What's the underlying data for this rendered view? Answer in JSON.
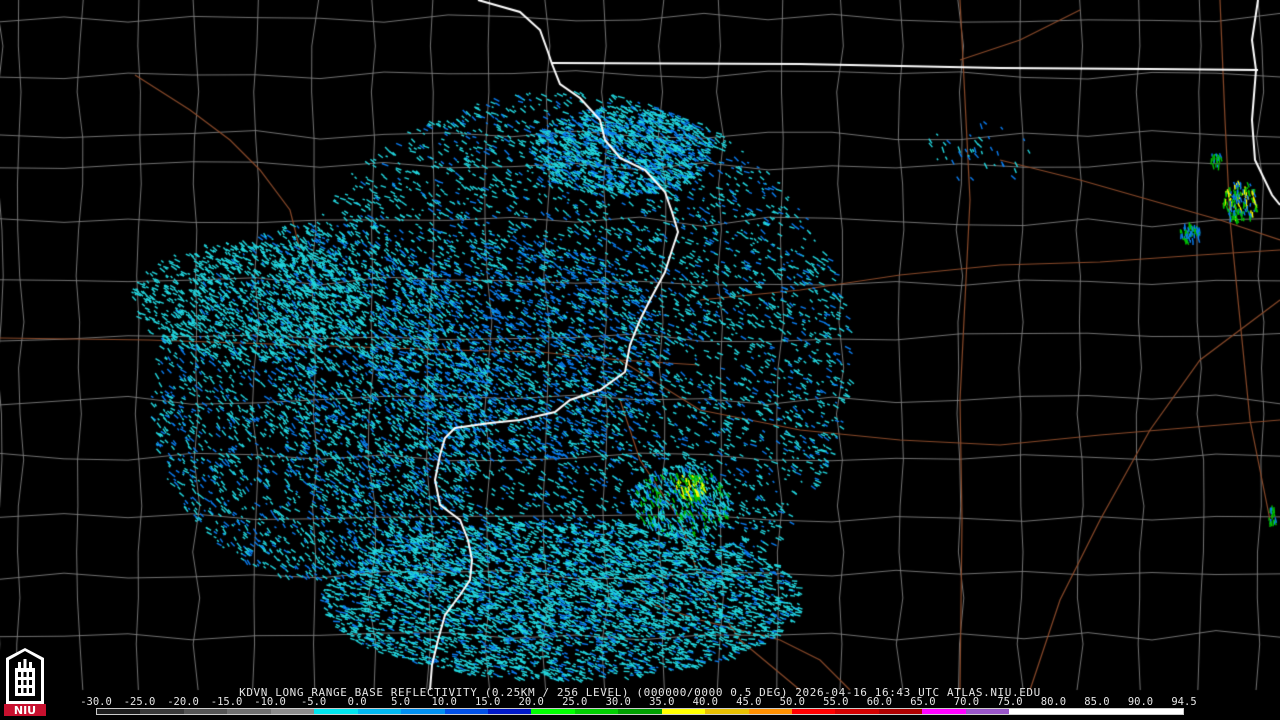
{
  "caption": {
    "station": "KDVN",
    "product": "LONG RANGE BASE REFLECTIVITY",
    "resolution": "(0.25KM / 256 LEVEL)",
    "volume": "(000000/0000 0.5 DEG)",
    "timestamp": "2026-04-16 16:43 UTC",
    "source": "ATLAS.NIU.EDU"
  },
  "scale": {
    "ticks": [
      "-30.0",
      "-25.0",
      "-20.0",
      "-15.0",
      "-10.0",
      "-5.0",
      "0.0",
      "5.0",
      "10.0",
      "15.0",
      "20.0",
      "25.0",
      "30.0",
      "35.0",
      "40.0",
      "45.0",
      "50.0",
      "55.0",
      "60.0",
      "65.0",
      "70.0",
      "75.0",
      "80.0",
      "85.0",
      "90.0",
      "94.5"
    ],
    "colors": [
      "#1e1e1e",
      "#3a3a3a",
      "#555555",
      "#6f6f6f",
      "#8c8c8c",
      "#00e5ee",
      "#00b8f0",
      "#0090f0",
      "#0050e8",
      "#0018c8",
      "#00ff00",
      "#00d000",
      "#00a000",
      "#ffff00",
      "#e8c000",
      "#ff9000",
      "#ff0000",
      "#d40000",
      "#b00000",
      "#ff00ff",
      "#9955c9",
      "#ffffff",
      "#ffffff",
      "#ffffff",
      "#ffffff"
    ]
  },
  "logo": {
    "text": "NIU"
  },
  "map": {
    "state_border_color": "#ffffff",
    "county_line_color": "#7f7f7f",
    "highway_color": "#8a4a2a",
    "echo_color_light": "#22d8e0",
    "echo_color_mid": "#0a7cf0",
    "echo_color_strong": "#00c000",
    "echo_color_max": "#ffff00",
    "icon": "radar-map-canvas"
  }
}
